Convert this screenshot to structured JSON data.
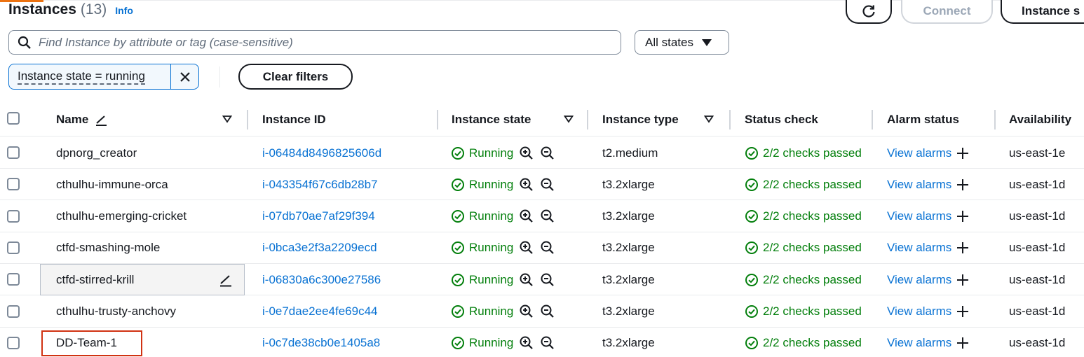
{
  "header": {
    "title": "Instances",
    "count": "(13)",
    "info": "Info"
  },
  "actions": {
    "refresh_icon": "refresh-icon",
    "connect": "Connect",
    "instance_state": "Instance s"
  },
  "search": {
    "placeholder": "Find Instance by attribute or tag (case-sensitive)",
    "value": ""
  },
  "state_filter": {
    "selected": "All states"
  },
  "filter_token": {
    "label": "Instance state = running"
  },
  "clear_filters": "Clear filters",
  "columns": {
    "name": "Name",
    "instance_id": "Instance ID",
    "instance_state": "Instance state",
    "instance_type": "Instance type",
    "status_check": "Status check",
    "alarm_status": "Alarm status",
    "availability": "Availability"
  },
  "colors": {
    "link": "#0972d3",
    "success": "#037f0c",
    "highlight": "#d13212"
  },
  "rows": [
    {
      "name": "dpnorg_creator",
      "id": "i-06484d8496825606d",
      "state": "Running",
      "type": "t2.medium",
      "status": "2/2 checks passed",
      "alarm": "View alarms",
      "az": "us-east-1e"
    },
    {
      "name": "cthulhu-immune-orca",
      "id": "i-043354f67c6db28b7",
      "state": "Running",
      "type": "t3.2xlarge",
      "status": "2/2 checks passed",
      "alarm": "View alarms",
      "az": "us-east-1d"
    },
    {
      "name": "cthulhu-emerging-cricket",
      "id": "i-07db70ae7af29f394",
      "state": "Running",
      "type": "t3.2xlarge",
      "status": "2/2 checks passed",
      "alarm": "View alarms",
      "az": "us-east-1d"
    },
    {
      "name": "ctfd-smashing-mole",
      "id": "i-0bca3e2f3a2209ecd",
      "state": "Running",
      "type": "t3.2xlarge",
      "status": "2/2 checks passed",
      "alarm": "View alarms",
      "az": "us-east-1d"
    },
    {
      "name": "ctfd-stirred-krill",
      "id": "i-06830a6c300e27586",
      "state": "Running",
      "type": "t3.2xlarge",
      "status": "2/2 checks passed",
      "alarm": "View alarms",
      "az": "us-east-1d"
    },
    {
      "name": "cthulhu-trusty-anchovy",
      "id": "i-0e7dae2ee4fe69c44",
      "state": "Running",
      "type": "t3.2xlarge",
      "status": "2/2 checks passed",
      "alarm": "View alarms",
      "az": "us-east-1d"
    },
    {
      "name": "DD-Team-1",
      "id": "i-0c7de38cb0e1405a8",
      "state": "Running",
      "type": "t3.2xlarge",
      "status": "2/2 checks passed",
      "alarm": "View alarms",
      "az": "us-east-1d"
    }
  ]
}
